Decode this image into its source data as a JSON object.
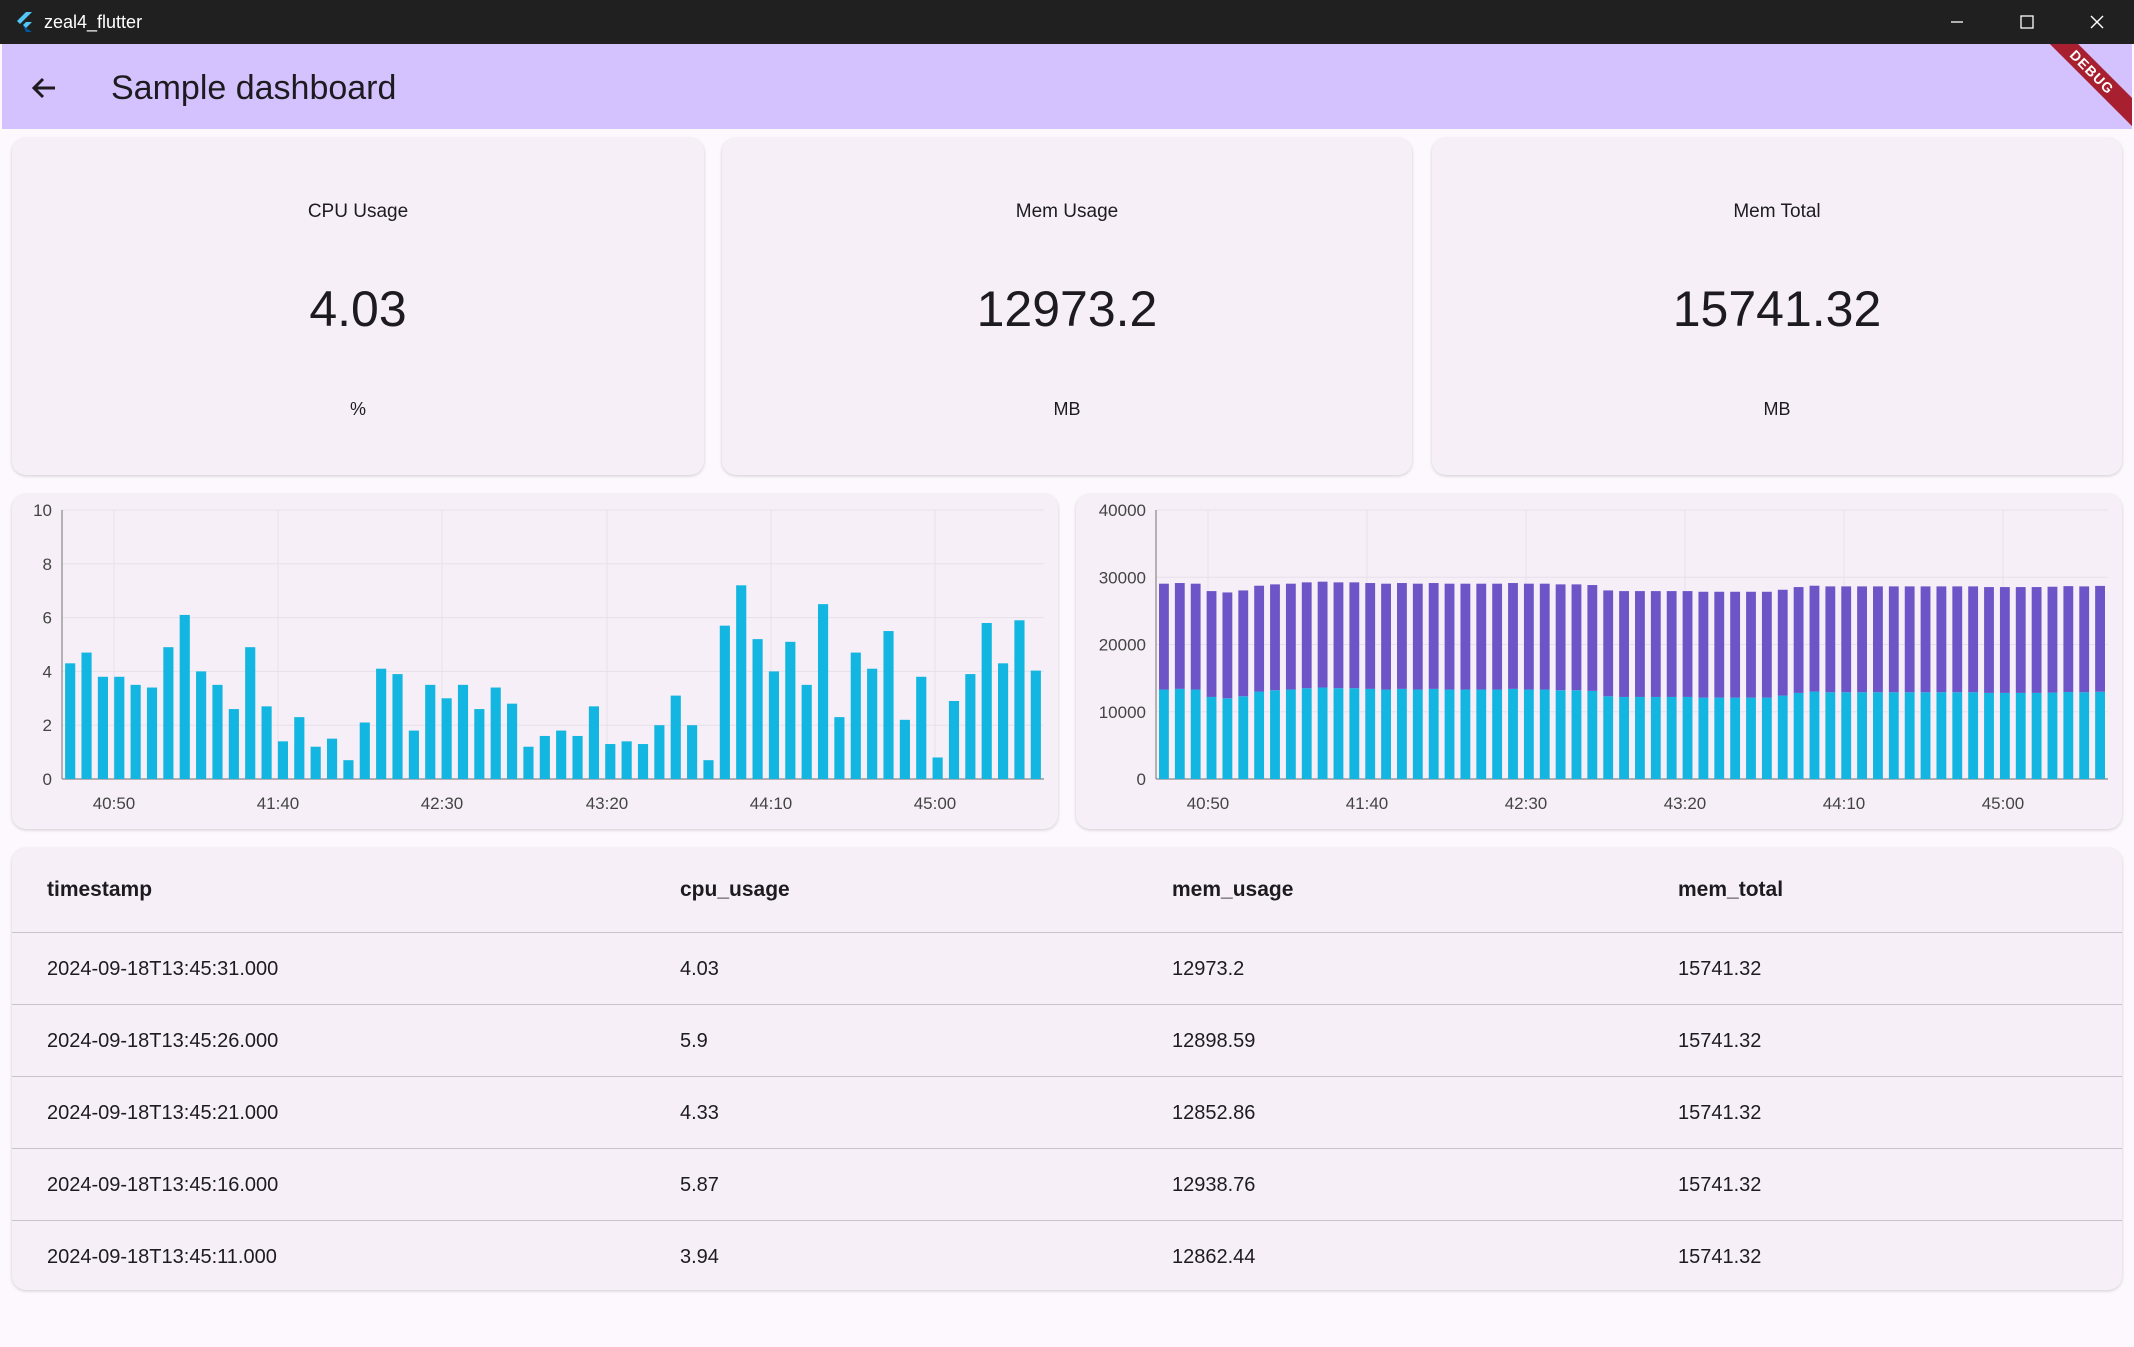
{
  "window": {
    "title": "zeal4_flutter"
  },
  "appbar": {
    "title": "Sample dashboard",
    "debug_label": "DEBUG"
  },
  "stats": [
    {
      "label": "CPU Usage",
      "value": "4.03",
      "unit": "%"
    },
    {
      "label": "Mem Usage",
      "value": "12973.2",
      "unit": "MB"
    },
    {
      "label": "Mem Total",
      "value": "15741.32",
      "unit": "MB"
    }
  ],
  "colors": {
    "bar_primary": "#13b6e0",
    "bar_secondary": "#6d55c8",
    "appbar": "#d3c2fd"
  },
  "chart_data": [
    {
      "type": "bar",
      "title": "",
      "x_tick_labels": [
        "40:50",
        "41:40",
        "42:30",
        "43:20",
        "44:10",
        "45:00"
      ],
      "ylim": [
        0,
        10
      ],
      "y_ticks": [
        0,
        2,
        4,
        6,
        8,
        10
      ],
      "grid": true,
      "series": [
        {
          "values": [
            4.3,
            4.7,
            3.8,
            3.8,
            3.5,
            3.4,
            4.9,
            6.1,
            4.0,
            3.5,
            2.6,
            4.9,
            2.7,
            1.4,
            2.3,
            1.2,
            1.5,
            0.7,
            2.1,
            4.1,
            3.9,
            1.8,
            3.5,
            3.0,
            3.5,
            2.6,
            3.4,
            2.8,
            1.2,
            1.6,
            1.8,
            1.6,
            2.7,
            1.3,
            1.4,
            1.3,
            2.0,
            3.1,
            2.0,
            0.7,
            5.7,
            7.2,
            5.2,
            4.0,
            5.1,
            3.5,
            6.5,
            2.3,
            4.7,
            4.1,
            5.5,
            2.2,
            3.8,
            0.8,
            2.9,
            3.9,
            5.8,
            4.3,
            5.9,
            4.03
          ]
        }
      ]
    },
    {
      "type": "bar",
      "stacked": true,
      "title": "",
      "x_tick_labels": [
        "40:50",
        "41:40",
        "42:30",
        "43:20",
        "44:10",
        "45:00"
      ],
      "ylim": [
        0,
        40000
      ],
      "y_ticks": [
        0,
        10000,
        20000,
        30000,
        40000
      ],
      "grid": true,
      "series": [
        {
          "values": [
            13300,
            13400,
            13300,
            12200,
            12000,
            12300,
            13000,
            13200,
            13300,
            13500,
            13600,
            13500,
            13500,
            13400,
            13300,
            13400,
            13300,
            13400,
            13300,
            13300,
            13300,
            13300,
            13400,
            13300,
            13300,
            13200,
            13200,
            13100,
            12300,
            12200,
            12200,
            12200,
            12200,
            12200,
            12100,
            12100,
            12100,
            12100,
            12100,
            12400,
            12800,
            13000,
            12900,
            12900,
            12900,
            12900,
            12900,
            12900,
            12900,
            12900,
            12900,
            12900,
            12800,
            12800,
            12800,
            12800,
            12850,
            12940,
            12900,
            12973
          ]
        },
        {
          "values": [
            15741,
            15741,
            15741,
            15741,
            15741,
            15741,
            15741,
            15741,
            15741,
            15741,
            15741,
            15741,
            15741,
            15741,
            15741,
            15741,
            15741,
            15741,
            15741,
            15741,
            15741,
            15741,
            15741,
            15741,
            15741,
            15741,
            15741,
            15741,
            15741,
            15741,
            15741,
            15741,
            15741,
            15741,
            15741,
            15741,
            15741,
            15741,
            15741,
            15741,
            15741,
            15741,
            15741,
            15741,
            15741,
            15741,
            15741,
            15741,
            15741,
            15741,
            15741,
            15741,
            15741,
            15741,
            15741,
            15741,
            15741,
            15741,
            15741,
            15741
          ]
        }
      ]
    }
  ],
  "table": {
    "columns": [
      "timestamp",
      "cpu_usage",
      "mem_usage",
      "mem_total"
    ],
    "rows": [
      [
        "2024-09-18T13:45:31.000",
        "4.03",
        "12973.2",
        "15741.32"
      ],
      [
        "2024-09-18T13:45:26.000",
        "5.9",
        "12898.59",
        "15741.32"
      ],
      [
        "2024-09-18T13:45:21.000",
        "4.33",
        "12852.86",
        "15741.32"
      ],
      [
        "2024-09-18T13:45:16.000",
        "5.87",
        "12938.76",
        "15741.32"
      ],
      [
        "2024-09-18T13:45:11.000",
        "3.94",
        "12862.44",
        "15741.32"
      ]
    ]
  }
}
